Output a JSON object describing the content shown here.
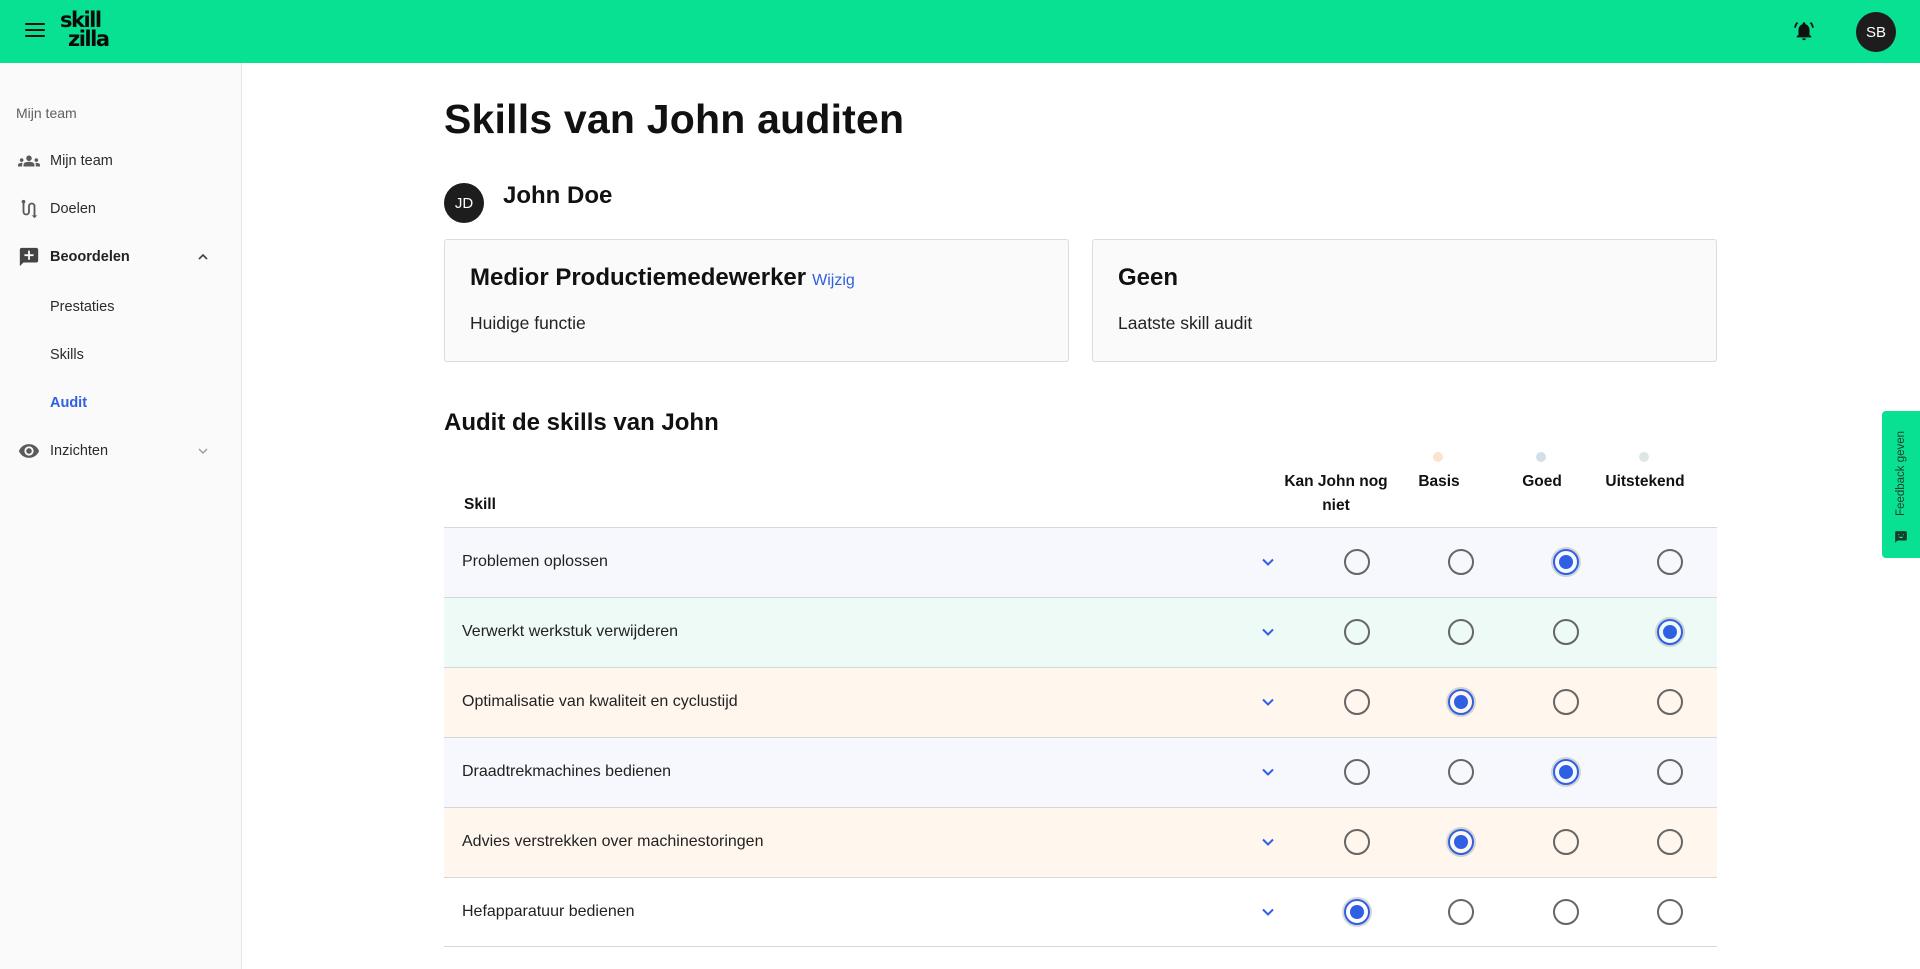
{
  "topbar": {
    "logo_line1": "skill",
    "logo_line2": "zilla",
    "avatar_initials": "SB",
    "icons": [
      "menu-icon",
      "bell-icon"
    ]
  },
  "sidebar": {
    "section_label": "Mijn team",
    "items": [
      {
        "label": "Mijn team",
        "icon": "people-icon"
      },
      {
        "label": "Doelen",
        "icon": "route-icon"
      },
      {
        "label": "Beoordelen",
        "icon": "add-comment-icon",
        "expanded": true
      },
      {
        "label": "Inzichten",
        "icon": "eye-icon",
        "expanded": false
      }
    ],
    "sub_items": [
      {
        "label": "Prestaties",
        "active": false
      },
      {
        "label": "Skills",
        "active": false
      },
      {
        "label": "Audit",
        "active": true
      }
    ]
  },
  "main": {
    "title": "Skills van John auditen",
    "person": {
      "initials": "JD",
      "name": "John Doe"
    },
    "cards": [
      {
        "title": "Medior Productiemedewerker",
        "link": "Wijzig",
        "subtitle": "Huidige functie"
      },
      {
        "title": "Geen",
        "subtitle": "Laatste skill audit"
      }
    ],
    "audit_title": "Audit de skills van John",
    "skill_header": "Skill",
    "levels": [
      {
        "label": "Kan John nog niet",
        "dot_color": ""
      },
      {
        "label": "Basis",
        "dot_color": "#fbe4cf"
      },
      {
        "label": "Goed",
        "dot_color": "#d4dee9"
      },
      {
        "label": "Uitstekend",
        "dot_color": "#dde7e0"
      }
    ],
    "skills": [
      {
        "name": "Problemen oplossen",
        "selected": 2,
        "bg": "#f6f8fd"
      },
      {
        "name": "Verwerkt werkstuk verwijderen",
        "selected": 3,
        "bg": "#eefaf5"
      },
      {
        "name": "Optimalisatie van kwaliteit en cyclustijd",
        "selected": 1,
        "bg": "#fff7ee"
      },
      {
        "name": "Draadtrekmachines bedienen",
        "selected": 2,
        "bg": "#f6f8fd"
      },
      {
        "name": "Advies verstrekken over machinestoringen",
        "selected": 1,
        "bg": "#fff7ee"
      },
      {
        "name": "Hefapparatuur bedienen",
        "selected": 0,
        "bg": "#ffffff"
      }
    ]
  },
  "feedback": {
    "label": "Feedback geven",
    "icon": "feedback-icon"
  }
}
